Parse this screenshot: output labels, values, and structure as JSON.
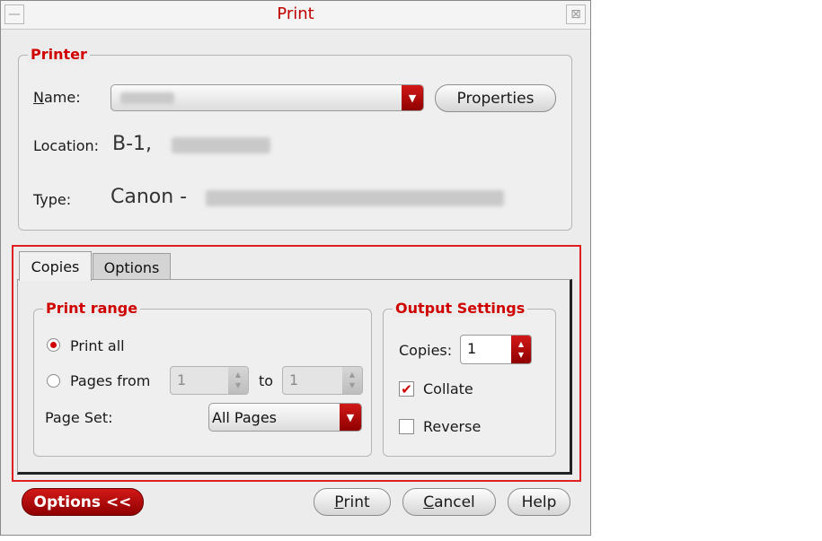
{
  "window": {
    "title": "Print",
    "menu_glyph": "—",
    "close_glyph": "⊠"
  },
  "printer": {
    "legend": "Printer",
    "name_label": "Name:",
    "properties_label": "Properties",
    "location_label": "Location:",
    "location_value": "B-1,",
    "type_label": "Type:",
    "type_value": "Canon -"
  },
  "tabs": [
    {
      "label": "Copies",
      "active": true
    },
    {
      "label": "Options",
      "active": false
    }
  ],
  "print_range": {
    "legend": "Print range",
    "print_all_label": "Print all",
    "pages_from_label": "Pages from",
    "from_value": "1",
    "to_label": "to",
    "to_value": "1",
    "page_set_label": "Page Set:",
    "page_set_value": "All Pages"
  },
  "output": {
    "legend": "Output Settings",
    "copies_label": "Copies:",
    "copies_value": "1",
    "collate_label": "Collate",
    "collate_checked": true,
    "reverse_label": "Reverse",
    "reverse_checked": false
  },
  "footer": {
    "options_label": "Options <<",
    "print_label": "Print",
    "cancel_label": "Cancel",
    "help_label": "Help"
  },
  "colors": {
    "accent": "#c00000",
    "highlight_frame": "#e02020"
  }
}
